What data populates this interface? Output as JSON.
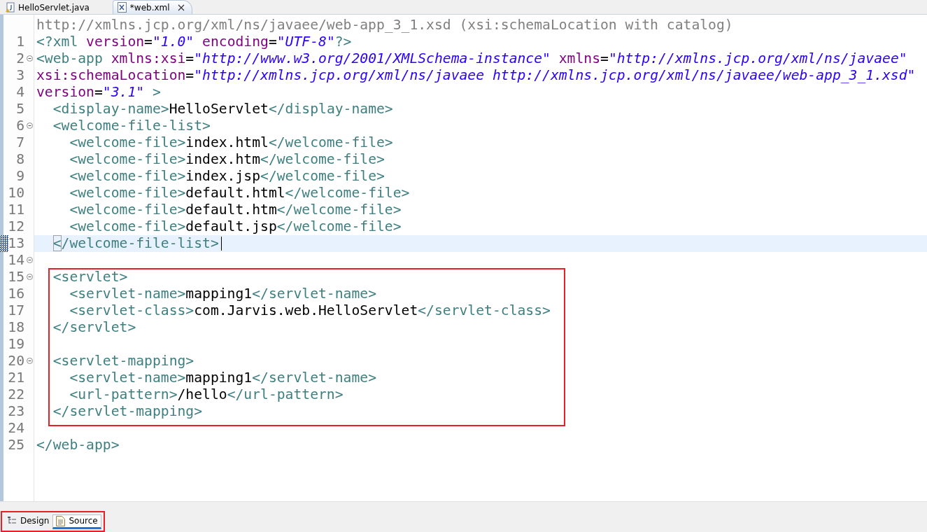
{
  "editor_tabs": [
    {
      "label": "HelloServlet.java",
      "kind": "java",
      "selected": false,
      "closable": false
    },
    {
      "label": "*web.xml",
      "kind": "xml",
      "selected": true,
      "closable": true
    }
  ],
  "schema_hint": "http://xmlns.jcp.org/xml/ns/javaee/web-app_3_1.xsd (xsi:schemaLocation with catalog)",
  "lines": [
    {
      "number": "1",
      "fold": false,
      "current": false,
      "segments": [
        {
          "kind": "pi",
          "text": "<?xml"
        },
        {
          "kind": "attr",
          "text": " version"
        },
        {
          "kind": "eq",
          "text": "="
        },
        {
          "kind": "str",
          "text": "\"1.0\""
        },
        {
          "kind": "attr",
          "text": " encoding"
        },
        {
          "kind": "eq",
          "text": "="
        },
        {
          "kind": "str",
          "text": "\"UTF-8\""
        },
        {
          "kind": "pi",
          "text": "?>"
        }
      ]
    },
    {
      "number": "2",
      "fold": true,
      "current": false,
      "segments": [
        {
          "kind": "tag",
          "text": "<web-app"
        },
        {
          "kind": "attr",
          "text": " xmlns:xsi"
        },
        {
          "kind": "eq",
          "text": "="
        },
        {
          "kind": "str",
          "text": "\"http://www.w3.org/2001/XMLSchema-instance\""
        },
        {
          "kind": "attr",
          "text": " xmlns"
        },
        {
          "kind": "eq",
          "text": "="
        },
        {
          "kind": "str",
          "text": "\"http://xmlns.jcp.org/xml/ns/javaee\""
        }
      ]
    },
    {
      "number": "3",
      "fold": false,
      "current": false,
      "segments": [
        {
          "kind": "attr",
          "text": "xsi:schemaLocation"
        },
        {
          "kind": "eq",
          "text": "="
        },
        {
          "kind": "str",
          "text": "\"http://xmlns.jcp.org/xml/ns/javaee http://xmlns.jcp.org/xml/ns/javaee/web-app_3_1.xsd\""
        }
      ]
    },
    {
      "number": "4",
      "fold": false,
      "current": false,
      "segments": [
        {
          "kind": "attr",
          "text": "version"
        },
        {
          "kind": "eq",
          "text": "="
        },
        {
          "kind": "str",
          "text": "\"3.1\""
        },
        {
          "kind": "tag",
          "text": " >"
        }
      ]
    },
    {
      "number": "5",
      "fold": false,
      "current": false,
      "segments": [
        {
          "kind": "tag",
          "text": "  <display-name>"
        },
        {
          "kind": "text",
          "text": "HelloServlet"
        },
        {
          "kind": "tag",
          "text": "</display-name>"
        }
      ]
    },
    {
      "number": "6",
      "fold": true,
      "current": false,
      "segments": [
        {
          "kind": "tag",
          "text": "  <welcome-file-list>"
        }
      ]
    },
    {
      "number": "7",
      "fold": false,
      "current": false,
      "segments": [
        {
          "kind": "tag",
          "text": "    <welcome-file>"
        },
        {
          "kind": "text",
          "text": "index.html"
        },
        {
          "kind": "tag",
          "text": "</welcome-file>"
        }
      ]
    },
    {
      "number": "8",
      "fold": false,
      "current": false,
      "segments": [
        {
          "kind": "tag",
          "text": "    <welcome-file>"
        },
        {
          "kind": "text",
          "text": "index.htm"
        },
        {
          "kind": "tag",
          "text": "</welcome-file>"
        }
      ]
    },
    {
      "number": "9",
      "fold": false,
      "current": false,
      "segments": [
        {
          "kind": "tag",
          "text": "    <welcome-file>"
        },
        {
          "kind": "text",
          "text": "index.jsp"
        },
        {
          "kind": "tag",
          "text": "</welcome-file>"
        }
      ]
    },
    {
      "number": "10",
      "fold": false,
      "current": false,
      "segments": [
        {
          "kind": "tag",
          "text": "    <welcome-file>"
        },
        {
          "kind": "text",
          "text": "default.html"
        },
        {
          "kind": "tag",
          "text": "</welcome-file>"
        }
      ]
    },
    {
      "number": "11",
      "fold": false,
      "current": false,
      "segments": [
        {
          "kind": "tag",
          "text": "    <welcome-file>"
        },
        {
          "kind": "text",
          "text": "default.htm"
        },
        {
          "kind": "tag",
          "text": "</welcome-file>"
        }
      ]
    },
    {
      "number": "12",
      "fold": false,
      "current": false,
      "segments": [
        {
          "kind": "tag",
          "text": "    <welcome-file>"
        },
        {
          "kind": "text",
          "text": "default.jsp"
        },
        {
          "kind": "tag",
          "text": "</welcome-file>"
        }
      ]
    },
    {
      "number": "13",
      "fold": false,
      "current": true,
      "segments": [
        {
          "kind": "match",
          "text": "  <"
        },
        {
          "kind": "tag",
          "text": "/welcome-file-list>"
        }
      ]
    },
    {
      "number": "14",
      "fold": true,
      "current": false
    },
    {
      "number": "15",
      "fold": true,
      "current": false,
      "segments": [
        {
          "kind": "tag",
          "text": "  <servlet>"
        }
      ]
    },
    {
      "number": "16",
      "fold": false,
      "current": false,
      "segments": [
        {
          "kind": "tag",
          "text": "    <servlet-name>"
        },
        {
          "kind": "text",
          "text": "mapping1"
        },
        {
          "kind": "tag",
          "text": "</servlet-name>"
        }
      ]
    },
    {
      "number": "17",
      "fold": false,
      "current": false,
      "segments": [
        {
          "kind": "tag",
          "text": "    <servlet-class>"
        },
        {
          "kind": "text",
          "text": "com.Jarvis.web.HelloServlet"
        },
        {
          "kind": "tag",
          "text": "</servlet-class>"
        }
      ]
    },
    {
      "number": "18",
      "fold": false,
      "current": false,
      "segments": [
        {
          "kind": "tag",
          "text": "  </servlet>"
        }
      ]
    },
    {
      "number": "19",
      "fold": false,
      "current": false
    },
    {
      "number": "20",
      "fold": true,
      "current": false,
      "segments": [
        {
          "kind": "tag",
          "text": "  <servlet-mapping>"
        }
      ]
    },
    {
      "number": "21",
      "fold": false,
      "current": false,
      "segments": [
        {
          "kind": "tag",
          "text": "    <servlet-name>"
        },
        {
          "kind": "text",
          "text": "mapping1"
        },
        {
          "kind": "tag",
          "text": "</servlet-name>"
        }
      ]
    },
    {
      "number": "22",
      "fold": false,
      "current": false,
      "segments": [
        {
          "kind": "tag",
          "text": "    <url-pattern>"
        },
        {
          "kind": "text",
          "text": "/hello"
        },
        {
          "kind": "tag",
          "text": "</url-pattern>"
        }
      ]
    },
    {
      "number": "23",
      "fold": false,
      "current": false,
      "segments": [
        {
          "kind": "tag",
          "text": "  </servlet-mapping>"
        }
      ]
    },
    {
      "number": "24",
      "fold": false,
      "current": false
    },
    {
      "number": "25",
      "fold": false,
      "current": false,
      "segments": [
        {
          "kind": "tag",
          "text": "</web-app>"
        }
      ]
    }
  ],
  "view_tabs": [
    {
      "label": "Design",
      "kind": "design",
      "selected": false
    },
    {
      "label": "Source",
      "kind": "source",
      "selected": true
    }
  ]
}
